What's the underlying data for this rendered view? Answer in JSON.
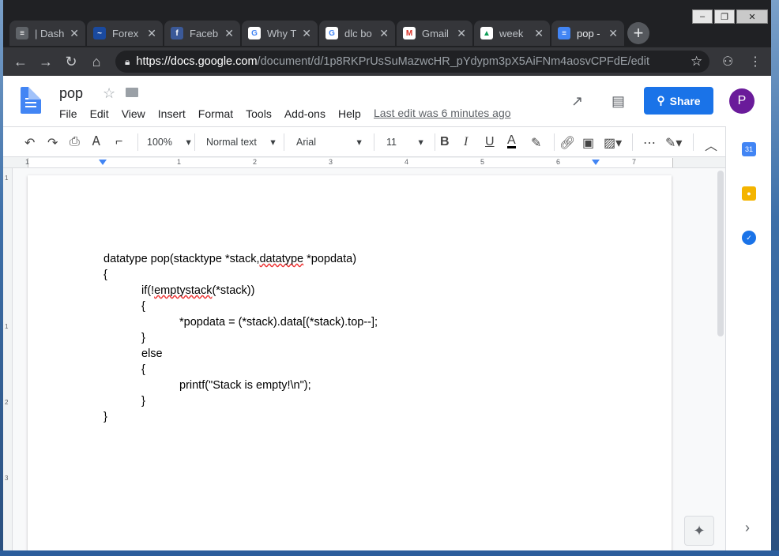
{
  "browser": {
    "tabs": [
      {
        "label": "| Dash",
        "icon": "layers-icon",
        "color": "#5f6368"
      },
      {
        "label": "Forex",
        "icon": "chart-icon",
        "color": "#1a4aa0"
      },
      {
        "label": "Faceb",
        "icon": "facebook-icon",
        "color": "#3b5998"
      },
      {
        "label": "Why T",
        "icon": "google-icon",
        "color": "#ffffff"
      },
      {
        "label": "dlc bo",
        "icon": "google-icon",
        "color": "#ffffff"
      },
      {
        "label": "Gmail",
        "icon": "gmail-icon",
        "color": "#ffffff"
      },
      {
        "label": "week",
        "icon": "drive-icon",
        "color": "#ffffff"
      },
      {
        "label": "pop -",
        "icon": "docs-icon",
        "color": "#4285f4"
      }
    ],
    "new_tab_label": "+",
    "url_domain": "https://docs.google.com",
    "url_path": "/document/d/1p8RKPrUsSuMazwcHR_pYdypm3pX5AiFNm4aosvCPFdE/edit",
    "window_controls": [
      "–",
      "❐",
      "✕"
    ]
  },
  "docs": {
    "title": "pop",
    "menu": [
      "File",
      "Edit",
      "View",
      "Insert",
      "Format",
      "Tools",
      "Add-ons",
      "Help"
    ],
    "last_edit": "Last edit was 6 minutes ago",
    "share_label": "Share",
    "avatar_letter": "P",
    "toolbar": {
      "zoom": "100%",
      "style": "Normal text",
      "font": "Arial",
      "size": "11"
    },
    "ruler_numbers": [
      "1",
      "1",
      "2",
      "3",
      "4",
      "5",
      "6",
      "7"
    ],
    "vruler_numbers": [
      "1",
      "1",
      "2",
      "3"
    ],
    "code_lines": [
      {
        "indent": 0,
        "text": "datatype pop(stacktype *stack,datatype *popdata)"
      },
      {
        "indent": 0,
        "text": "{"
      },
      {
        "indent": 1,
        "text": "if(!emptystack(*stack))"
      },
      {
        "indent": 1,
        "text": "{"
      },
      {
        "indent": 2,
        "text": "*popdata = (*stack).data[(*stack).top--];"
      },
      {
        "indent": 1,
        "text": "}"
      },
      {
        "indent": 1,
        "text": "else"
      },
      {
        "indent": 1,
        "text": "{"
      },
      {
        "indent": 2,
        "text": "printf(\"Stack is empty!\\n\");"
      },
      {
        "indent": 1,
        "text": "}"
      },
      {
        "indent": 0,
        "text": "}"
      }
    ]
  }
}
